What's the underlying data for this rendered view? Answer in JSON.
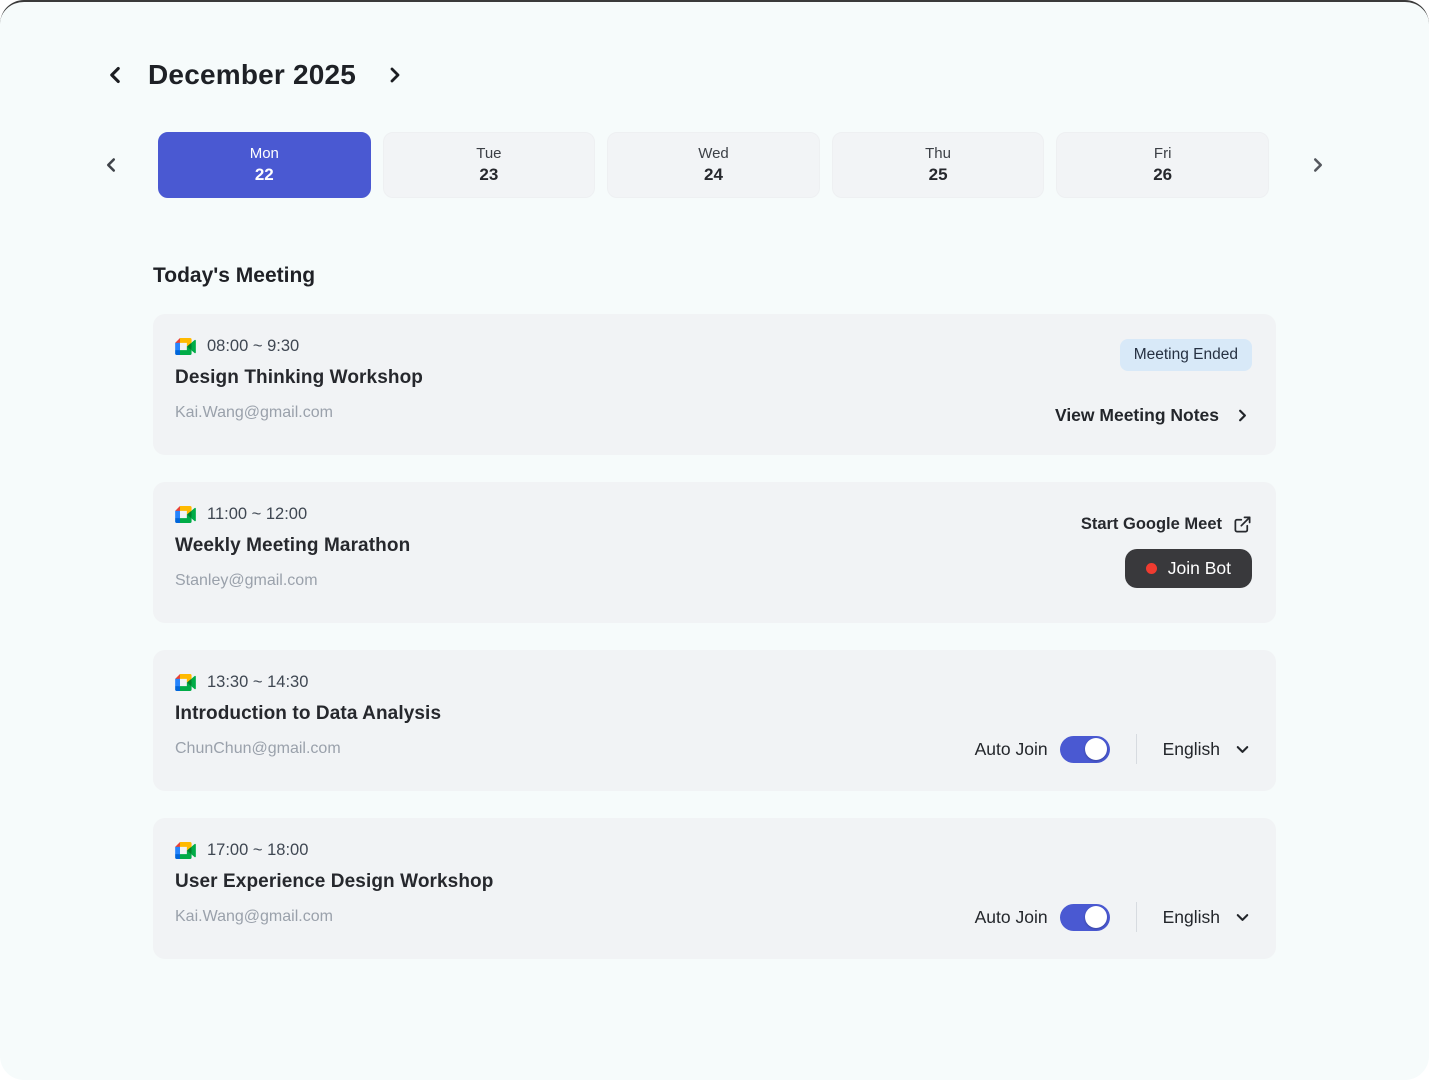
{
  "header": {
    "title": "December 2025"
  },
  "day_strip": {
    "days": [
      {
        "label": "Mon",
        "date": "22",
        "selected": true
      },
      {
        "label": "Tue",
        "date": "23",
        "selected": false
      },
      {
        "label": "Wed",
        "date": "24",
        "selected": false
      },
      {
        "label": "Thu",
        "date": "25",
        "selected": false
      },
      {
        "label": "Fri",
        "date": "26",
        "selected": false
      }
    ]
  },
  "meetings_section": {
    "title": "Today's Meeting",
    "meetings": [
      {
        "time": "08:00 ~ 9:30",
        "title": "Design Thinking Workshop",
        "organizer": "Kai.Wang@gmail.com",
        "status": "Meeting Ended",
        "notes_link": "View Meeting Notes"
      },
      {
        "time": "11:00 ~ 12:00",
        "title": "Weekly Meeting Marathon",
        "organizer": "Stanley@gmail.com",
        "meet_link": "Start Google Meet",
        "join_button": "Join Bot"
      },
      {
        "time": "13:30 ~ 14:30",
        "title": "Introduction to Data Analysis",
        "organizer": "ChunChun@gmail.com",
        "toggle_label": "Auto Join",
        "auto_join_on": true,
        "language": "English"
      },
      {
        "time": "17:00 ~ 18:00",
        "title": "User Experience Design Workshop",
        "organizer": "Kai.Wang@gmail.com",
        "toggle_label": "Auto Join",
        "auto_join_on": true,
        "language": "English"
      }
    ]
  },
  "icons": {
    "month_prev": "chevron-left",
    "month_next": "chevron-right",
    "strip_prev": "chevron-left",
    "strip_next": "chevron-right",
    "meeting_app": "google-meet",
    "open_external": "external-link",
    "recording_dot": "red-dot",
    "notes_forward": "chevron-right",
    "language_expand": "chevron-down"
  },
  "colors": {
    "accent": "#4a59d2",
    "page_bg": "#f6fbfb",
    "card_bg": "#f1f3f5",
    "badge_bg": "#d8e9f8",
    "join_bot_bg": "#39393c",
    "dot": "#f03b30"
  }
}
